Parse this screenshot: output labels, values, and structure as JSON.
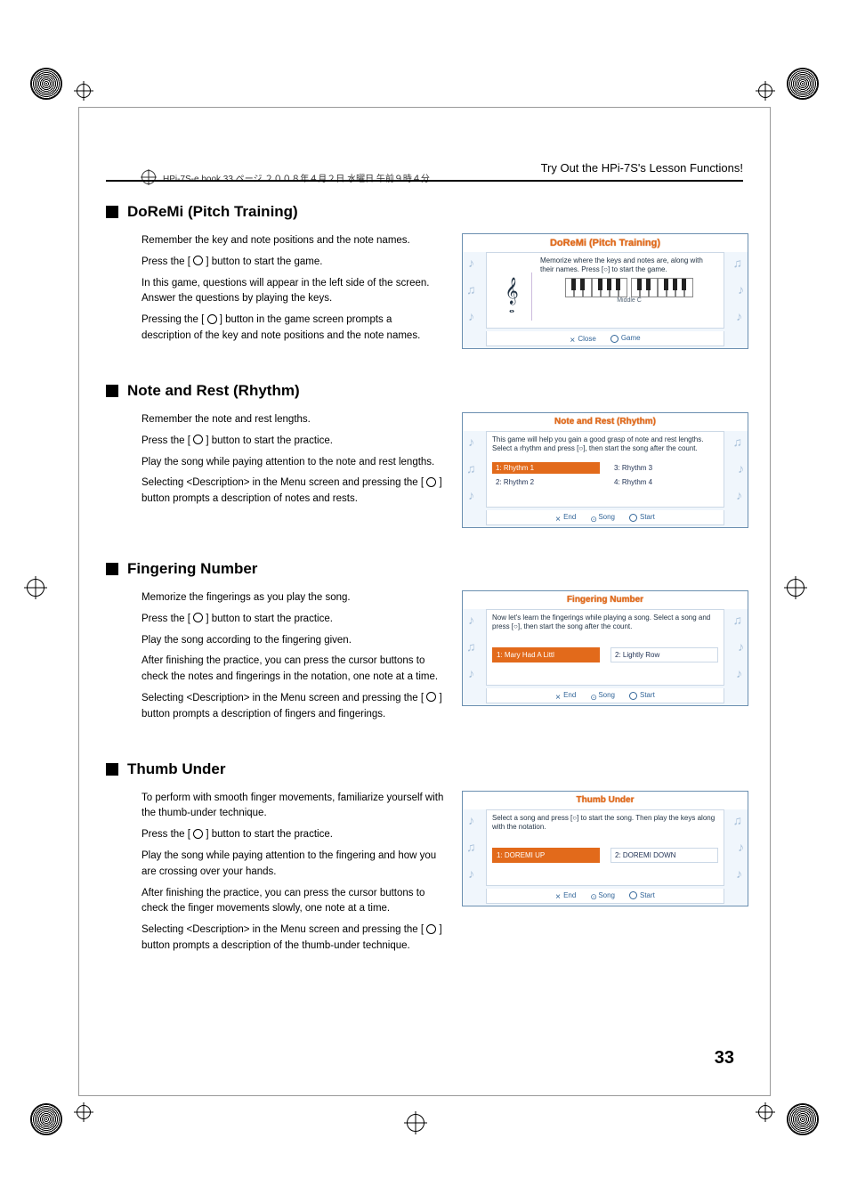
{
  "header_meta": "HPi-7S-e.book 33 ページ ２００８年４月２日 水曜日 午前９時４分",
  "running_head": "Try Out the HPi-7S's Lesson Functions!",
  "page_number": "33",
  "sections": {
    "doremi": {
      "title": "DoReMi (Pitch Training)",
      "p1": "Remember the key and note positions and the note names.",
      "p2a": "Press the [ ",
      "p2b": " ] button to start the game.",
      "p3": "In this game, questions will appear in the left side of the screen. Answer the questions by playing the keys.",
      "p4a": "Pressing the [ ",
      "p4b": " ] button in the game screen prompts a description of the key and note positions and the note names.",
      "panel": {
        "title": "DoReMi (Pitch Training)",
        "desc": "Memorize where the keys and notes are, along with their names. Press [○] to start the game.",
        "mode": "Middle C",
        "btn_close": "Close",
        "btn_game": "Game"
      }
    },
    "noterest": {
      "title": "Note and Rest (Rhythm)",
      "p1": "Remember the note and rest lengths.",
      "p2a": "Press the [ ",
      "p2b": " ] button to start the practice.",
      "p3": "Play the song while paying attention to the note and rest lengths.",
      "p4a": "Selecting <Description> in the Menu screen and pressing the [ ",
      "p4b": " ] button prompts a description of notes and rests.",
      "panel": {
        "title": "Note and Rest (Rhythm)",
        "desc": "This game will help you gain a good grasp of note and rest lengths. Select a rhythm and press [○], then start the song after the count.",
        "items": [
          "1: Rhythm  1",
          "3: Rhythm  3",
          "2: Rhythm  2",
          "4: Rhythm  4"
        ],
        "btn_end": "End",
        "btn_song": "Song",
        "btn_start": "Start"
      }
    },
    "fingering": {
      "title": "Fingering Number",
      "p1": "Memorize the fingerings as you play the song.",
      "p2a": "Press the [ ",
      "p2b": " ] button to start the practice.",
      "p3": "Play the song according to the fingering given.",
      "p4": "After finishing the practice, you can press the cursor buttons to check the notes and fingerings in the notation, one note at a time.",
      "p5a": "Selecting <Description> in the Menu screen and pressing the [ ",
      "p5b": " ] button prompts a description of fingers and fingerings.",
      "panel": {
        "title": "Fingering Number",
        "desc": "Now let's learn the fingerings while playing a song. Select a song and press [○], then start the song after the count.",
        "items": [
          "1: Mary Had A Littl",
          "2: Lightly Row"
        ],
        "btn_end": "End",
        "btn_song": "Song",
        "btn_start": "Start"
      }
    },
    "thumb": {
      "title": "Thumb Under",
      "p1": "To perform with smooth finger movements, familiarize yourself with the thumb-under technique.",
      "p2a": "Press the [ ",
      "p2b": " ] button to start the practice.",
      "p3": "Play the song while paying attention to the fingering and how you are crossing over your hands.",
      "p4": "After finishing the practice, you can press the cursor buttons to check the finger movements slowly, one note at a time.",
      "p5a": "Selecting <Description> in the Menu screen and pressing the [ ",
      "p5b": " ] button prompts a description of the thumb-under technique.",
      "panel": {
        "title": "Thumb Under",
        "desc": "Select a song and press [○] to start the song. Then play the keys along with the notation.",
        "items": [
          "1: DOREMI UP",
          "2: DOREMI DOWN"
        ],
        "btn_end": "End",
        "btn_song": "Song",
        "btn_start": "Start"
      }
    }
  }
}
